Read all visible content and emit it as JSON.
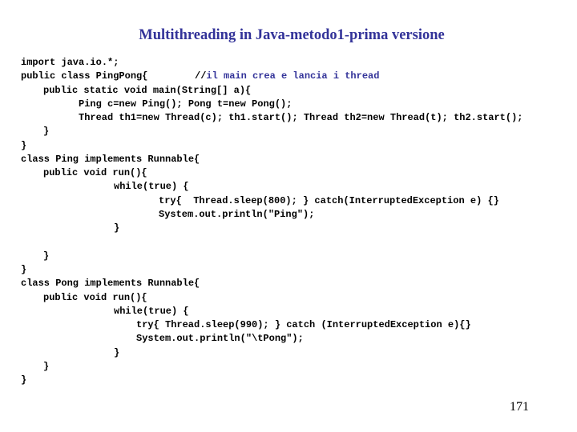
{
  "slide": {
    "title": "Multithreading in Java-metodo1-prima versione",
    "page_number": "171",
    "accent_color": "#333399"
  },
  "code": {
    "lines": [
      {
        "indent": 0,
        "text": "import java.io.*;"
      },
      {
        "indent": 0,
        "text": "public class PingPong{",
        "comment_prefix": "//",
        "comment": "il main crea e lancia i thread"
      },
      {
        "indent": 4,
        "text": "public static void main(String[] a){"
      },
      {
        "indent": 10,
        "text": "Ping c=new Ping(); Pong t=new Pong();"
      },
      {
        "indent": 10,
        "text": "Thread th1=new Thread(c); th1.start(); Thread th2=new Thread(t); th2.start();"
      },
      {
        "indent": 4,
        "text": "}"
      },
      {
        "indent": 0,
        "text": "}"
      },
      {
        "indent": 0,
        "text": "class Ping implements Runnable{"
      },
      {
        "indent": 4,
        "text": "public void run(){"
      },
      {
        "indent": 16,
        "text": "while(true) {"
      },
      {
        "indent": 24,
        "text": "try{  Thread.sleep(800); } catch(InterruptedException e) {}"
      },
      {
        "indent": 24,
        "text": "System.out.println(\"Ping\");"
      },
      {
        "indent": 16,
        "text": "}"
      },
      {
        "indent": 0,
        "text": ""
      },
      {
        "indent": 4,
        "text": "}"
      },
      {
        "indent": 0,
        "text": "}"
      },
      {
        "indent": 0,
        "text": "class Pong implements Runnable{"
      },
      {
        "indent": 4,
        "text": "public void run(){"
      },
      {
        "indent": 16,
        "text": "while(true) {"
      },
      {
        "indent": 20,
        "text": "try{ Thread.sleep(990); } catch (InterruptedException e){}"
      },
      {
        "indent": 20,
        "text": "System.out.println(\"\\tPong\");"
      },
      {
        "indent": 16,
        "text": "}"
      },
      {
        "indent": 4,
        "text": "}"
      },
      {
        "indent": 0,
        "text": "}"
      }
    ]
  }
}
